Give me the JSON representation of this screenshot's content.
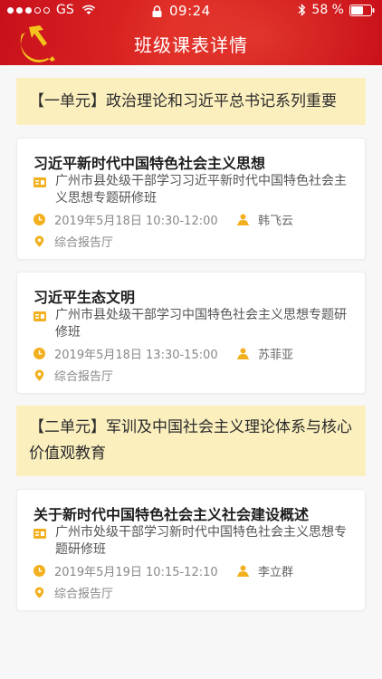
{
  "status_bar": {
    "carrier": "GS",
    "time": "09:24",
    "battery": "58 %"
  },
  "header": {
    "title": "班级课表详情"
  },
  "units": [
    {
      "title": "【一单元】政治理论和习近平总书记系列重要",
      "courses": [
        {
          "title": "习近平新时代中国特色社会主义思想",
          "class": "广州市县处级干部学习习近平新时代中国特色社会主义思想专题研修班",
          "datetime": "2019年5月18日 10:30-12:00",
          "teacher": "韩飞云",
          "location": "综合报告厅"
        },
        {
          "title": "习近平生态文明",
          "class": "广州市县处级干部学习中国特色社会主义思想专题研修班",
          "datetime": "2019年5月18日 13:30-15:00",
          "teacher": "苏菲亚",
          "location": "综合报告厅"
        }
      ]
    },
    {
      "title": "【二单元】军训及中国社会主义理论体系与核心价值观教育",
      "courses": [
        {
          "title": "关于新时代中国特色社会主义社会建设概述",
          "class": "广州市处级干部学习新时代中国特色社会主义思想专题研修班",
          "datetime": "2019年5月19日 10:15-12:10",
          "teacher": "李立群",
          "location": "综合报告厅"
        }
      ]
    }
  ],
  "colors": {
    "header_red": "#d41e22",
    "banner_yellow": "#fbefbe",
    "icon_gold": "#f2b01e"
  },
  "icons": {
    "class": "id-card-icon",
    "time": "clock-icon",
    "teacher": "teacher-icon",
    "location": "location-pin-icon"
  }
}
